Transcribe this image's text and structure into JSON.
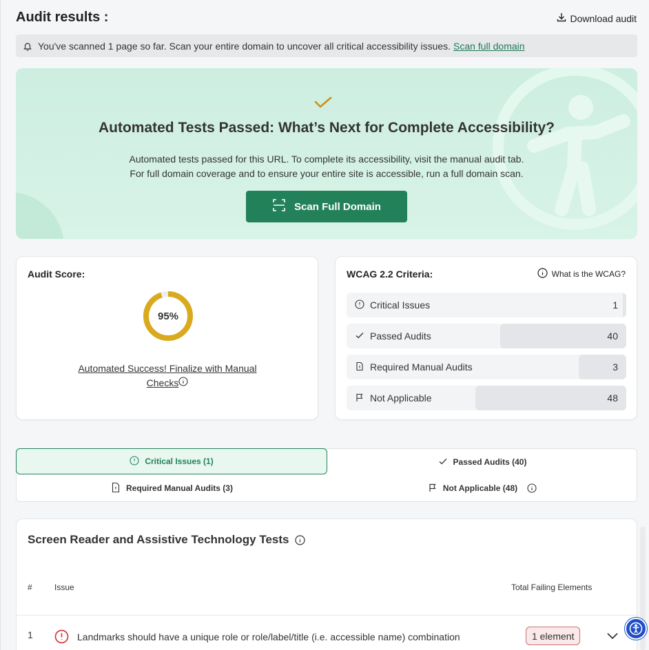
{
  "header": {
    "title": "Audit results :",
    "download_label": "Download audit"
  },
  "notice": {
    "text": "You've scanned 1 page so far. Scan your entire domain to uncover all critical accessibility issues.",
    "link": "Scan full domain"
  },
  "hero": {
    "title": "Automated Tests Passed: What’s Next for Complete Accessibility?",
    "line1": "Automated tests passed for this URL. To complete its accessibility, visit the manual audit tab.",
    "line2": "For full domain coverage and to ensure your entire site is accessible, run a full domain scan.",
    "button": "Scan Full Domain"
  },
  "score": {
    "title": "Audit Score:",
    "value": 95,
    "value_label": "95%",
    "link_line1": "Automated Success! Finalize with Manual",
    "link_line2": "Checks",
    "color": "#d9aa1e"
  },
  "wcag": {
    "title": "WCAG 2.2 Criteria:",
    "help": "What is the WCAG?",
    "rows": [
      {
        "label": "Critical Issues",
        "value": "1",
        "fraction": 0.01,
        "icon": "alert-circle-icon"
      },
      {
        "label": "Passed Audits",
        "value": "40",
        "fraction": 0.45,
        "icon": "check-icon"
      },
      {
        "label": "Required Manual Audits",
        "value": "3",
        "fraction": 0.17,
        "icon": "document-icon"
      },
      {
        "label": "Not Applicable",
        "value": "48",
        "fraction": 0.54,
        "icon": "flag-icon"
      }
    ]
  },
  "tabs": [
    {
      "label": "Critical Issues (1)",
      "active": true
    },
    {
      "label": "Passed Audits (40)",
      "active": false
    },
    {
      "label": "Required Manual Audits (3)",
      "active": false
    },
    {
      "label": "Not Applicable (48)",
      "active": false
    }
  ],
  "table": {
    "title": "Screen Reader and Assistive Technology Tests",
    "columns": {
      "num": "#",
      "issue": "Issue",
      "failing": "Total Failing Elements"
    },
    "rows": [
      {
        "num": "1",
        "issue": "Landmarks should have a unique role or role/label/title (i.e. accessible name) combination",
        "failing": "1 element"
      }
    ]
  },
  "colors": {
    "accent": "#23815a",
    "hero_bg": "#cdeee1",
    "error": "#d33b3b"
  }
}
